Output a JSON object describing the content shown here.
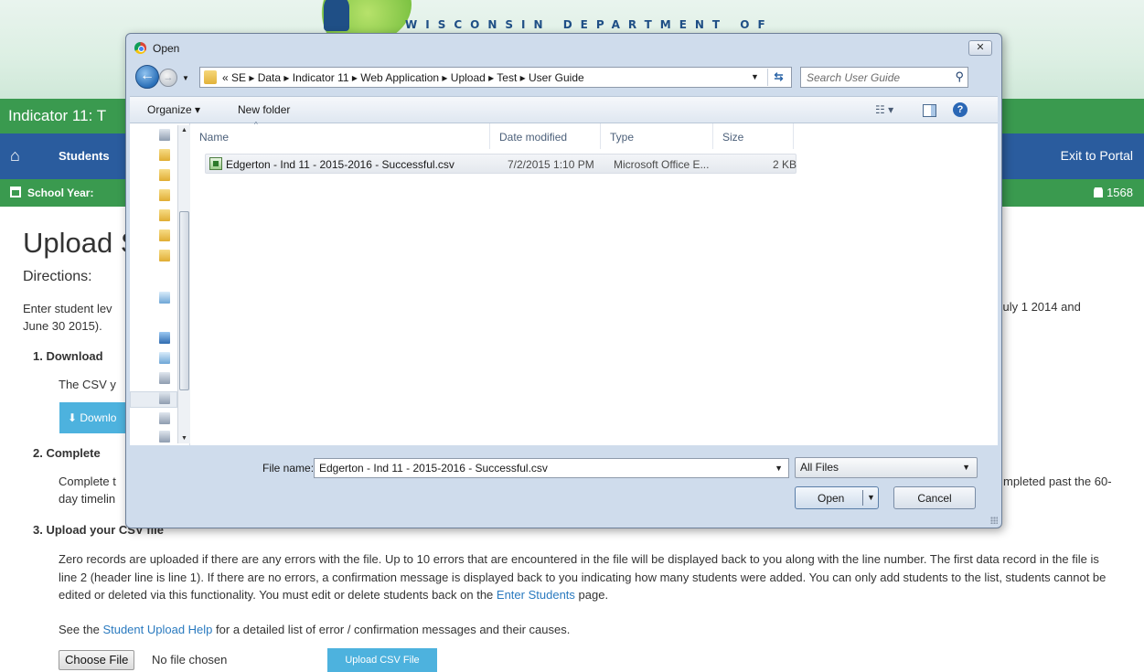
{
  "background_page": {
    "banner_title": "WISCONSIN DEPARTMENT OF",
    "app_title": "Indicator 11: T",
    "nav": {
      "students_label": "Students",
      "exit_label": "Exit to Portal"
    },
    "year_label": "School Year:",
    "user_count": "1568",
    "heading": "Upload S",
    "directions_label": "Directions:",
    "intro_left_line1": "Enter student lev",
    "intro_left_line2": "June 30 2015).",
    "intro_right": "July 1 2014 and",
    "step1_title": "1. Download",
    "step1_text": "The CSV y",
    "download_button": "Downlo",
    "step2_title": "2. Complete",
    "step2_text_line1": "Complete t",
    "step2_text_line2": "day timelin",
    "step2_right": "mpleted past the 60-",
    "step3_title": "3. Upload your CSV file",
    "step3_para_before_link": "Zero records are uploaded if there are any errors with the file. Up to 10 errors that are encountered in the file will be displayed back to you along with the line number. The first data record in the file is line 2 (header line is line 1). If there are no errors, a confirmation message is displayed back to you indicating how many students were added. You can only add students to the list, students cannot be edited or deleted via this functionality. You must edit or delete students back on the ",
    "step3_link": "Enter Students",
    "step3_para_after_link": " page.",
    "help_before": "See the ",
    "help_link": "Student Upload Help",
    "help_after": " for a detailed list of error / confirmation messages and their causes.",
    "choose_file_button": "Choose File",
    "no_file_text": "No file chosen",
    "upload_button": "Upload CSV File"
  },
  "dialog": {
    "title": "Open",
    "close_label": "✕",
    "breadcrumbs": "« SE ▸ Data ▸ Indicator 11 ▸ Web Application ▸ Upload ▸ Test ▸ User Guide",
    "search_placeholder": "Search User Guide",
    "toolbar": {
      "organize_label": "Organize ▾",
      "new_folder_label": "New folder"
    },
    "columns": [
      "Name",
      "Date modified",
      "Type",
      "Size"
    ],
    "files": [
      {
        "name": "Edgerton - Ind 11 - 2015-2016 - Successful.csv",
        "date_modified": "7/2/2015 1:10 PM",
        "type": "Microsoft Office E...",
        "size": "2 KB"
      }
    ],
    "file_name_label": "File name:",
    "file_name_value": "Edgerton - Ind 11 - 2015-2016 - Successful.csv",
    "file_type_value": "All Files",
    "open_button": "Open",
    "cancel_button": "Cancel"
  },
  "colors": {
    "green_bar": "#3a9a4f",
    "blue_nav": "#2a5c9e",
    "button_blue": "#4db2de",
    "link": "#2a7abf",
    "dialog_frame": "#cfdcec"
  },
  "icons": [
    "home-icon",
    "calendar-icon",
    "user-icon",
    "chrome-icon",
    "back-arrow-icon",
    "forward-arrow-icon",
    "folder-icon",
    "refresh-icon",
    "search-icon",
    "view-icon",
    "preview-pane-icon",
    "help-icon",
    "csv-file-icon",
    "download-icon"
  ]
}
